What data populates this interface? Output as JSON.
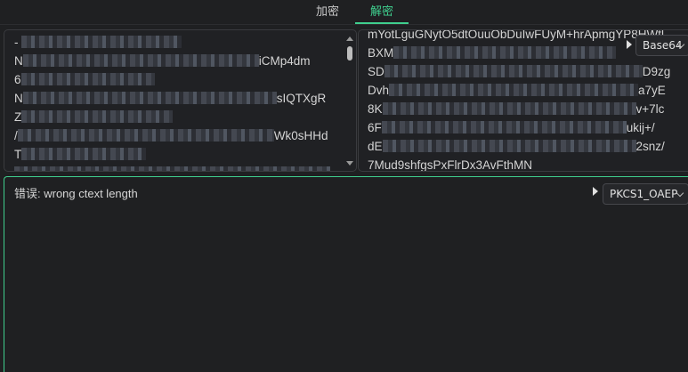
{
  "tabs": {
    "encrypt": "加密",
    "decrypt": "解密"
  },
  "input_panel": {
    "lines": [
      {
        "pre": "- ",
        "mosaic": 180,
        "post": ""
      },
      {
        "pre": "N",
        "mosaic": 265,
        "post": "iCMp4dm"
      },
      {
        "pre": "6",
        "mosaic": 150,
        "post": ""
      },
      {
        "pre": "N",
        "mosaic": 285,
        "post": "sIQTXgR"
      },
      {
        "pre": "Z",
        "mosaic": 170,
        "post": ""
      },
      {
        "pre": "/",
        "mosaic": 288,
        "post": "Wk0sHHd"
      },
      {
        "pre": "T",
        "mosaic": 140,
        "post": ""
      },
      {
        "pre": "",
        "mosaic": 355,
        "post": ""
      }
    ]
  },
  "key_panel": {
    "lines": [
      {
        "pre": "mYotLguGNytO5dtOuuObDuIwFUyM+hrApmgYP8HWtl",
        "mosaic": 0,
        "post": ""
      },
      {
        "pre": "BXM",
        "mosaic": 250,
        "post": ""
      },
      {
        "pre": "SD",
        "mosaic": 290,
        "post": "D9zg"
      },
      {
        "pre": "Dvh",
        "mosaic": 280,
        "post": "a7yE"
      },
      {
        "pre": "8K",
        "mosaic": 285,
        "post": "v+7lc"
      },
      {
        "pre": "6F",
        "mosaic": 275,
        "post": "ukij+/"
      },
      {
        "pre": "dE",
        "mosaic": 285,
        "post": "2snz/"
      },
      {
        "pre": "7Mud9shfgsPxFlrDx3AvFthMN",
        "mosaic": 0,
        "post": ""
      }
    ],
    "encoding": "Base64"
  },
  "output_panel": {
    "error_text": "错误: wrong ctext length",
    "padding": "PKCS1_OAEP"
  }
}
